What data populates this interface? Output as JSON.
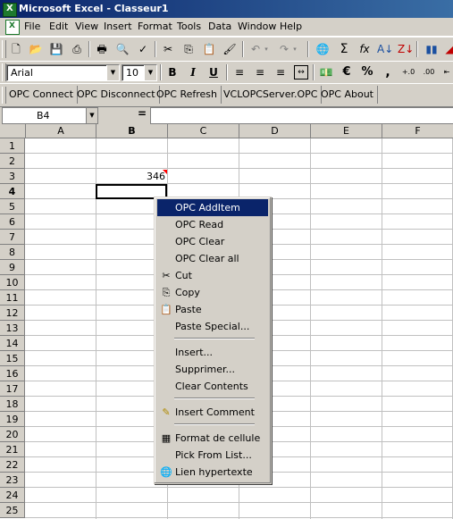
{
  "window": {
    "title": "Microsoft Excel - Classeur1"
  },
  "menubar": {
    "items": [
      "File",
      "Edit",
      "View",
      "Insert",
      "Format",
      "Tools",
      "Data",
      "Window",
      "Help"
    ]
  },
  "format_toolbar": {
    "font": "Arial",
    "size": "10",
    "bold": "B",
    "italic": "I",
    "underline": "U",
    "euro": "€",
    "percent": "%",
    "comma": ","
  },
  "opc_toolbar": {
    "buttons": [
      "OPC Connect",
      "OPC Disconnect",
      "OPC Refresh",
      "VCLOPCServer.OPC",
      "OPC About"
    ]
  },
  "formula_bar": {
    "name_box": "B4",
    "equals": "=",
    "value": ""
  },
  "sheet": {
    "columns": [
      "A",
      "B",
      "C",
      "D",
      "E",
      "F"
    ],
    "rows": [
      "1",
      "2",
      "3",
      "4",
      "5",
      "6",
      "7",
      "8",
      "9",
      "10",
      "11",
      "12",
      "13",
      "14",
      "15",
      "16",
      "17",
      "18",
      "19",
      "20",
      "21",
      "22",
      "23",
      "24",
      "25"
    ],
    "cell_b3": "346",
    "active_cell": "B4"
  },
  "context_menu": {
    "items": [
      {
        "label": "OPC AddItem",
        "icon": "",
        "selected": true
      },
      {
        "label": "OPC Read",
        "icon": ""
      },
      {
        "label": "OPC Clear",
        "icon": ""
      },
      {
        "label": "OPC Clear all",
        "icon": ""
      },
      {
        "label": "Cut",
        "icon": "scissors-icon"
      },
      {
        "label": "Copy",
        "icon": "copy-icon"
      },
      {
        "label": "Paste",
        "icon": "paste-icon"
      },
      {
        "label": "Paste Special...",
        "icon": ""
      },
      {
        "label": "Insert...",
        "icon": ""
      },
      {
        "label": "Supprimer...",
        "icon": ""
      },
      {
        "label": "Clear Contents",
        "icon": ""
      },
      {
        "label": "Insert Comment",
        "icon": "comment-icon"
      },
      {
        "label": "Format de cellule",
        "icon": "format-cells-icon"
      },
      {
        "label": "Pick From List...",
        "icon": ""
      },
      {
        "label": "Lien hypertexte",
        "icon": "hyperlink-icon"
      }
    ]
  }
}
